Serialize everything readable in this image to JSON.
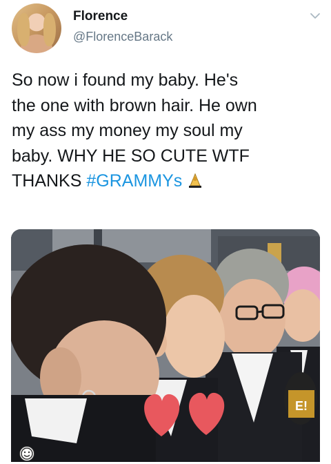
{
  "user": {
    "display_name": "Florence",
    "handle": "@FlorenceBarack"
  },
  "tweet": {
    "lines": [
      "So now i found my baby. He's",
      "the one with brown hair. He own",
      "my ass my money my soul my",
      "baby. WHY HE SO CUTE WTF"
    ],
    "last_line_prefix": "THANKS ",
    "hashtag": "#GRAMMYs",
    "hashtag_emoji": "trophy-icon"
  },
  "media": {
    "description_icon": "photo",
    "mic_logo": "E!"
  },
  "colors": {
    "link": "#1b95e0",
    "handle": "#657786",
    "text": "#14171a",
    "heart": "#e8585e"
  }
}
